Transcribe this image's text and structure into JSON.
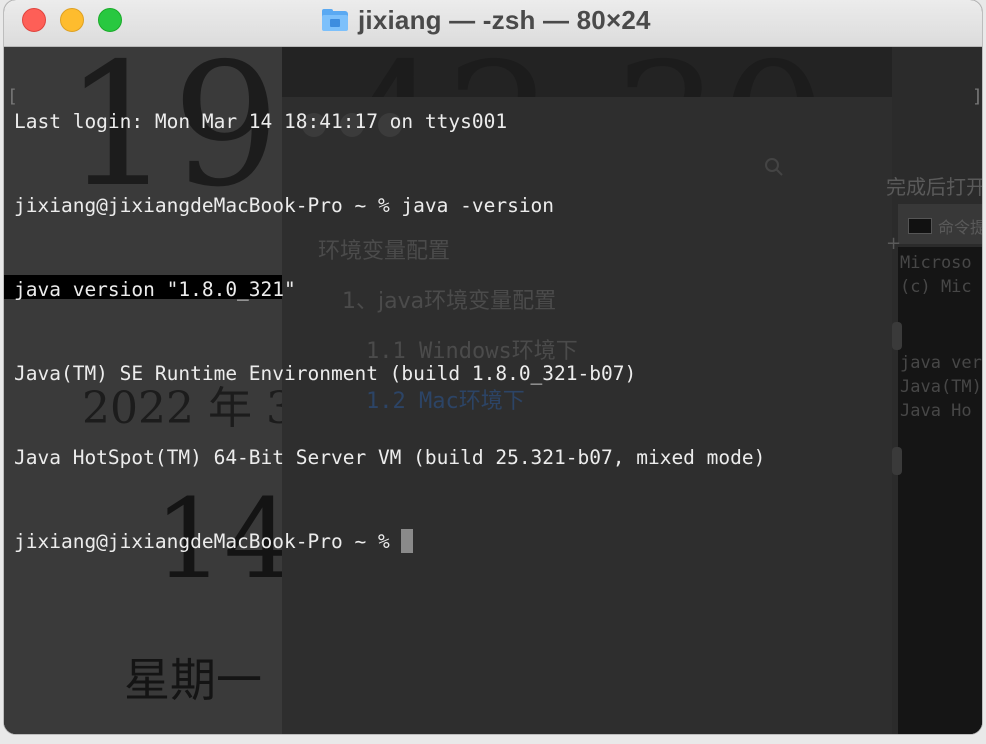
{
  "window": {
    "title": "jixiang — -zsh — 80×24",
    "folder_icon": "home-folder-icon"
  },
  "terminal": {
    "lines": [
      "Last login: Mon Mar 14 18:41:17 on ttys001",
      "jixiang@jixiangdeMacBook-Pro ~ % java -version",
      "java version \"1.8.0_321\"",
      "Java(TM) SE Runtime Environment (build 1.8.0_321-b07)",
      "Java HotSpot(TM) 64-Bit Server VM (build 25.321-b07, mixed mode)",
      "jixiang@jixiangdeMacBook-Pro ~ % "
    ]
  },
  "background_clock": {
    "time": "19:42:30",
    "date": "2022 年 3",
    "day": "14",
    "weekday": "星期一"
  },
  "background_doc": {
    "toc_title": "环境变量配置",
    "toc_items": [
      "1、java环境变量配置",
      "1.1 Windows环境下",
      "1.2 Mac环境下"
    ]
  },
  "background_right": {
    "heading": "完成后打开",
    "cmd_label": "命令提",
    "console_lines": [
      "Microso",
      "(c) Mic",
      "java ver",
      "Java(TM)",
      "Java Ho"
    ]
  },
  "colors": {
    "terminal_bg": "#232323",
    "terminal_fg": "#ececec",
    "close": "#fe5f57",
    "minimize": "#febc2e",
    "zoom": "#28c840"
  }
}
